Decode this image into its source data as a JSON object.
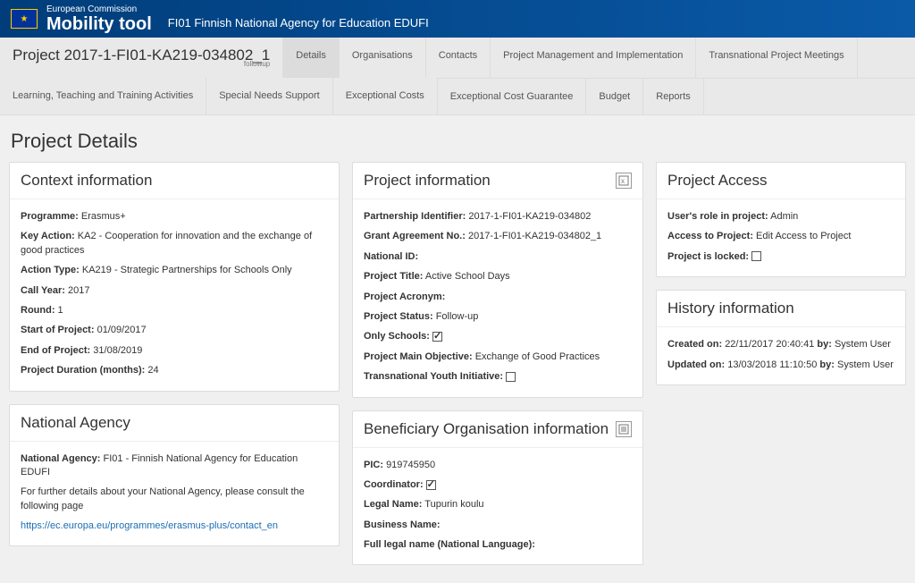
{
  "header": {
    "small_line": "European Commission",
    "brand": "Mobility tool",
    "agency": "FI01 Finnish National Agency for Education EDUFI"
  },
  "project_code": "Project 2017-1-FI01-KA219-034802_1",
  "followup_label": "followup",
  "tabs": {
    "details": "Details",
    "organisations": "Organisations",
    "contacts": "Contacts",
    "pmi": "Project Management and Implementation",
    "tpm": "Transnational Project Meetings",
    "ltta": "Learning, Teaching and Training Activities",
    "sns": "Special Needs Support",
    "ec": "Exceptional Costs",
    "ecg": "Exceptional Cost Guarantee",
    "budget": "Budget",
    "reports": "Reports"
  },
  "page_title": "Project Details",
  "context": {
    "card_title": "Context information",
    "programme_label": "Programme:",
    "programme_value": "Erasmus+",
    "key_action_label": "Key Action:",
    "key_action_value": "KA2 - Cooperation for innovation and the exchange of good practices",
    "action_type_label": "Action Type:",
    "action_type_value": "KA219 - Strategic Partnerships for Schools Only",
    "call_year_label": "Call Year:",
    "call_year_value": "2017",
    "round_label": "Round:",
    "round_value": "1",
    "start_label": "Start of Project:",
    "start_value": "01/09/2017",
    "end_label": "End of Project:",
    "end_value": "31/08/2019",
    "duration_label": "Project Duration (months):",
    "duration_value": "24"
  },
  "national_agency": {
    "card_title": "National Agency",
    "na_label": "National Agency:",
    "na_value": "FI01 - Finnish National Agency for Education EDUFI",
    "na_help": "For further details about your National Agency, please consult the following page",
    "na_link": "https://ec.europa.eu/programmes/erasmus-plus/contact_en"
  },
  "project_info": {
    "card_title": "Project information",
    "pi_label": "Partnership Identifier:",
    "pi_value": "2017-1-FI01-KA219-034802",
    "ga_label": "Grant Agreement No.:",
    "ga_value": "2017-1-FI01-KA219-034802_1",
    "nid_label": "National ID:",
    "nid_value": "",
    "title_label": "Project Title:",
    "title_value": "Active School Days",
    "acronym_label": "Project Acronym:",
    "acronym_value": "",
    "status_label": "Project Status:",
    "status_value": "Follow-up",
    "only_schools_label": "Only Schools:",
    "main_obj_label": "Project Main Objective:",
    "main_obj_value": "Exchange of Good Practices",
    "tyi_label": "Transnational Youth Initiative:"
  },
  "beneficiary": {
    "card_title": "Beneficiary Organisation information",
    "pic_label": "PIC:",
    "pic_value": "919745950",
    "coord_label": "Coordinator:",
    "legal_label": "Legal Name:",
    "legal_value": "Tupurin koulu",
    "business_label": "Business Name:",
    "business_value": "",
    "full_legal_label": "Full legal name (National Language):",
    "full_legal_value": ""
  },
  "project_access": {
    "card_title": "Project Access",
    "role_label": "User's role in project:",
    "role_value": "Admin",
    "access_label": "Access to Project:",
    "access_link": "Edit Access to Project",
    "locked_label": "Project is locked:"
  },
  "history": {
    "card_title": "History information",
    "created_label": "Created on:",
    "created_value": "22/11/2017 20:40:41",
    "by_label": "by:",
    "created_by": "System User",
    "updated_label": "Updated on:",
    "updated_value": "13/03/2018 11:10:50",
    "updated_by": "System User"
  }
}
